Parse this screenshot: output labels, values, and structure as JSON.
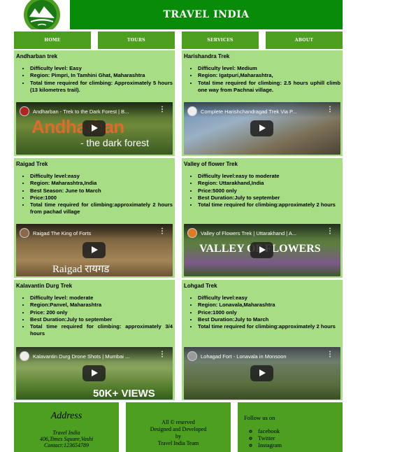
{
  "header": {
    "title": "TRAVEL INDIA"
  },
  "nav": [
    {
      "label": "HOME"
    },
    {
      "label": "TOURS"
    },
    {
      "label": "SERVICES"
    },
    {
      "label": "ABOUT"
    }
  ],
  "treks": [
    {
      "title": "Andharban trek",
      "details": [
        "Difficulty level: Easy",
        "Region: Pimpri, In Tamhini Ghat, Maharashtra",
        "Total time required for climbing: Approximately 5 hours (13 kilometres trail)."
      ],
      "video_title": "Andharban - Trek to the Dark Forest | B...",
      "video_overlay": "Andharban",
      "video_overlay_sub": "- the dark forest"
    },
    {
      "title": "Harishandra Trek",
      "details": [
        "Difficulty level: Medium",
        "Region: Igatpuri,Maharashtra,",
        "Total time required for climbing: 2.5 hours uphill climb one way from Pachnai village."
      ],
      "video_title": "Complete Harishchandragad Trek Via P...",
      "video_overlay": "",
      "video_overlay_sub": ""
    },
    {
      "title": "Raigad Trek",
      "details": [
        "Difficulty level:easy",
        "Region: Maharashtra,India",
        "Best Season: June to March",
        "Price:1000",
        "Total time required for climbing:approximately 2 hours from pachad village"
      ],
      "video_title": "Raigad The King of Forts",
      "video_overlay": "Raigad रायगड",
      "video_overlay_sub": ""
    },
    {
      "title": "Valley of flower Trek",
      "details": [
        "Difficulty level:easy to moderate",
        "Region: Uttarakhand,India",
        "Price:5000 only",
        "Best Duration:July to september",
        "Total time required for climbing:approximately 2 hours"
      ],
      "video_title": "Valley of Flowers Trek | Uttarakhand | A...",
      "video_overlay": "VALLEY OF FLOWERS",
      "video_overlay_sub": ""
    },
    {
      "title": "Kalavantin Durg Trek",
      "details": [
        "Difficulty level: moderate",
        "Region:Panvel, Maharashtra",
        "Price: 200 only",
        "Best Duration:July to september",
        "Total time required for climbing: approximately 3/4 hours"
      ],
      "video_title": "Kalavantin Durg Drone Shots | Mumbai ...",
      "video_overlay": "50K+ VIEWS",
      "video_overlay_sub": ""
    },
    {
      "title": "Lohgad Trek",
      "details": [
        "Difficulty level:easy",
        "Region: Lonavala,Maharashtra",
        "Price:1000 only",
        "Best Duration:July to March",
        "Total time required for climbing:approximately 2 hours"
      ],
      "video_title": "Lohagad Fort - Lonavala in Monsoon",
      "video_overlay": "",
      "video_overlay_sub": ""
    }
  ],
  "footer": {
    "address_title": "Address",
    "address_lines": [
      "Travel India",
      "406,Times Square,Vashi",
      "Contact:123654789"
    ],
    "copyright_lines": [
      "All © reserved",
      "Designed and Developed",
      "by",
      "Travel India Team"
    ],
    "follow_title": "Follow us on",
    "social_links": [
      "facebook",
      "Twitter",
      "Instagram"
    ]
  },
  "colors": {
    "header_green": "#088b08",
    "nav_green": "#4c9f1f",
    "card_green": "#a7dd85"
  },
  "icons": {
    "logo": "mountain-logo-icon",
    "play": "play-icon",
    "menu": "more-vert-icon"
  }
}
